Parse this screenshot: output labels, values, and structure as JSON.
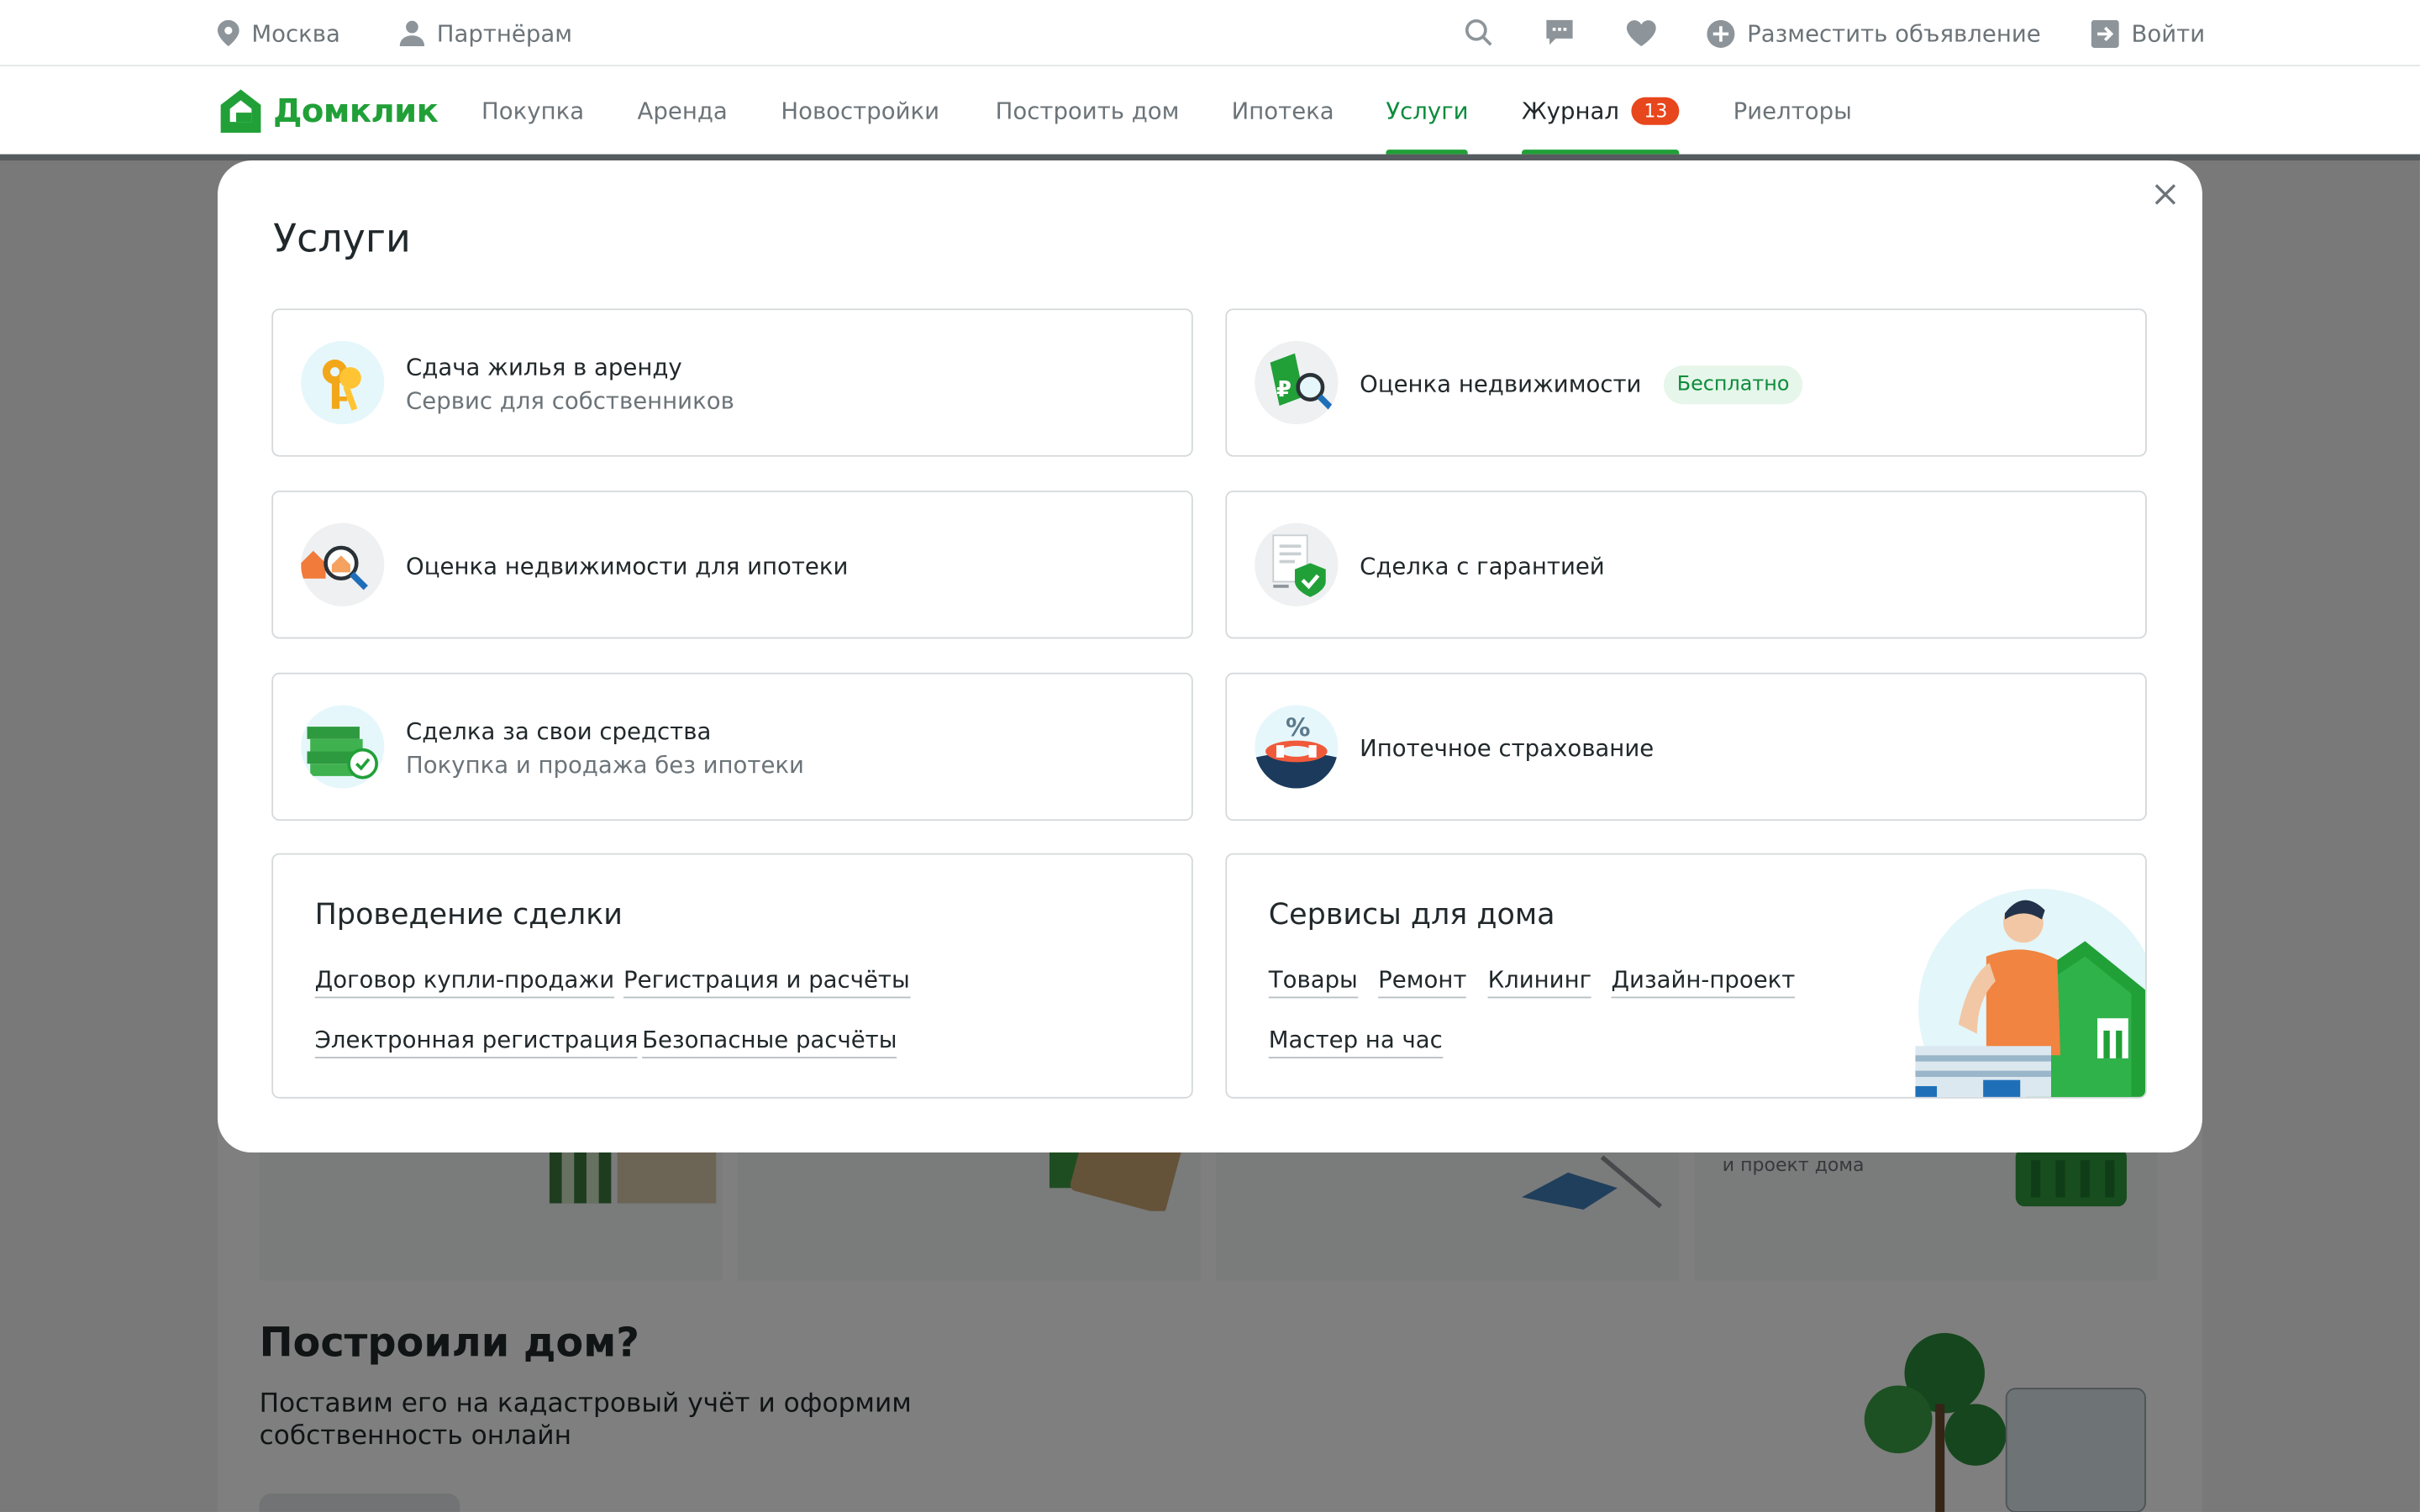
{
  "topbar": {
    "city": "Москва",
    "partners": "Партнёрам",
    "post_ad": "Разместить объявление",
    "login": "Войти"
  },
  "nav": {
    "logo": "Домклик",
    "items": [
      {
        "label": "Покупка"
      },
      {
        "label": "Аренда"
      },
      {
        "label": "Новостройки"
      },
      {
        "label": "Построить дом"
      },
      {
        "label": "Ипотека"
      },
      {
        "label": "Услуги"
      },
      {
        "label": "Журнал",
        "badge": "13"
      },
      {
        "label": "Риелторы"
      }
    ]
  },
  "background": {
    "small_text": "и проект дома",
    "heading": "Построили дом?",
    "text": "Поставим его на кадастровый учёт и оформим собственность онлайн"
  },
  "modal": {
    "title": "Услуги",
    "cards": [
      {
        "title": "Сдача жилья в аренду",
        "subtitle": "Сервис для собственников"
      },
      {
        "title": "Оценка недвижимости",
        "badge": "Бесплатно"
      },
      {
        "title": "Оценка недвижимости для ипотеки"
      },
      {
        "title": "Сделка с гарантией"
      },
      {
        "title": "Сделка за свои средства",
        "subtitle": "Покупка и продажа без ипотеки"
      },
      {
        "title": "Ипотечное страхование"
      }
    ],
    "deal": {
      "title": "Проведение сделки",
      "links": [
        "Договор купли-продажи",
        "Регистрация и расчёты",
        "Электронная регистрация",
        "Безопасные расчёты"
      ]
    },
    "home": {
      "title": "Сервисы для дома",
      "links": [
        "Товары",
        "Ремонт",
        "Клининг",
        "Дизайн-проект",
        "Мастер на час"
      ]
    }
  },
  "colors": {
    "brand": "#21a038",
    "brand_dark": "#0c8c3c",
    "badge": "#e8461c",
    "text": "#21282b",
    "muted": "#6c7479"
  }
}
